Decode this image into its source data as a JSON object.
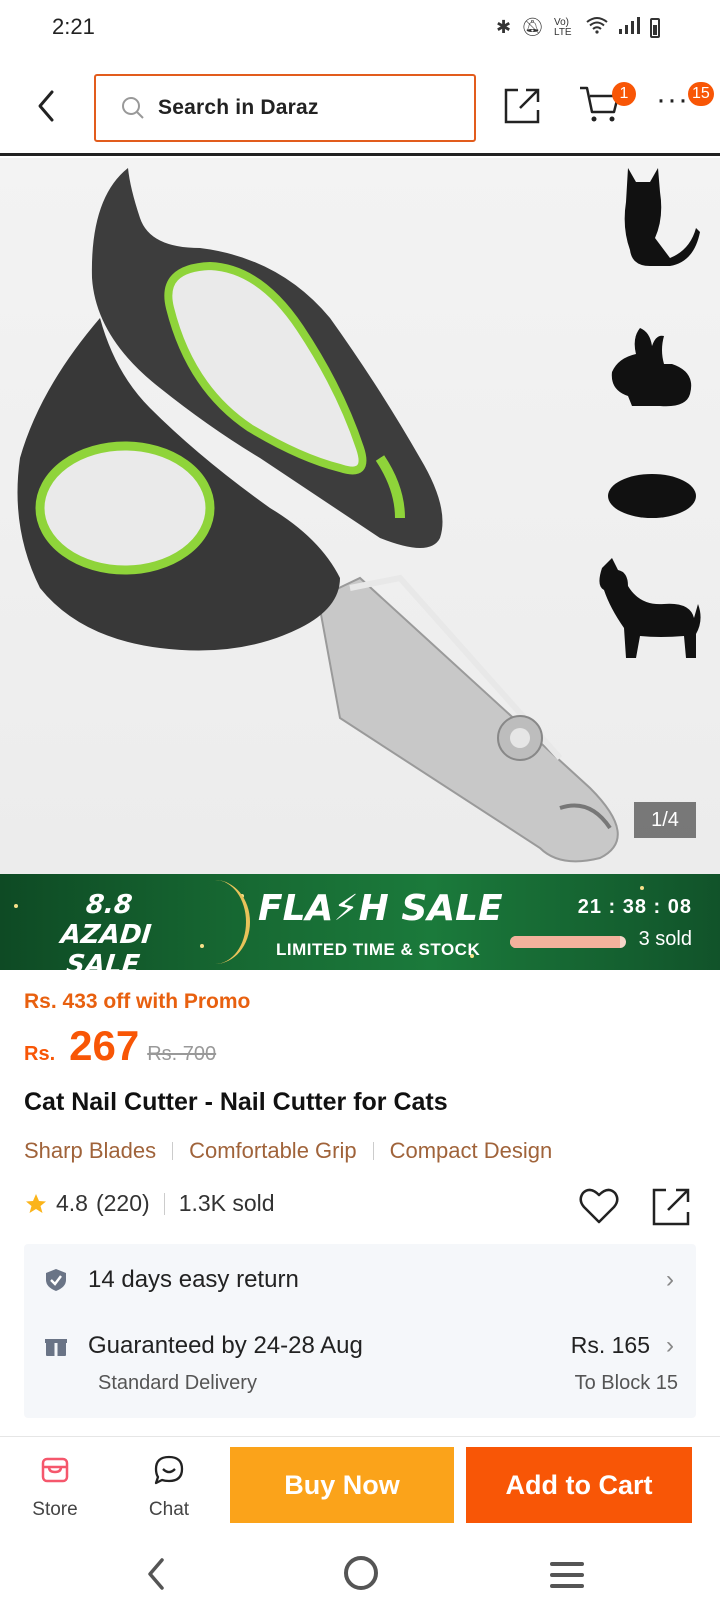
{
  "status_bar": {
    "time": "2:21",
    "network_label": "Vo) LTE"
  },
  "top_nav": {
    "search_placeholder": "Search in Daraz",
    "cart_count": "1",
    "more_count": "15"
  },
  "gallery": {
    "counter": "1/4"
  },
  "flash_banner": {
    "event_line1": "8.8 AZADI",
    "event_line2": "SALE",
    "title": "FLA⚡H SALE",
    "subtitle": "LIMITED TIME & STOCK",
    "countdown": "21 : 38 : 08",
    "sold": "3 sold",
    "sold_progress": 0.95
  },
  "price": {
    "promo": "Rs. 433 off with Promo",
    "currency": "Rs.",
    "current": "267",
    "original": "Rs. 700"
  },
  "product": {
    "title": "Cat Nail Cutter - Nail Cutter for Cats",
    "features": [
      "Sharp Blades",
      "Comfortable Grip",
      "Compact Design"
    ],
    "rating": "4.8",
    "reviews": "(220)",
    "sold": "1.3K sold"
  },
  "services": {
    "return_text": "14 days easy return",
    "delivery_text": "Guaranteed by 24-28 Aug",
    "delivery_type": "Standard Delivery",
    "delivery_fee": "Rs. 165",
    "delivery_location": "To Block 15"
  },
  "action_bar": {
    "store_label": "Store",
    "chat_label": "Chat",
    "buy_now_label": "Buy Now",
    "add_to_cart_label": "Add to Cart"
  },
  "colors": {
    "brand_orange": "#f85606",
    "buy_now_yellow": "#fba31a",
    "feature_brown": "#a0633a",
    "banner_green": "#176a33"
  }
}
